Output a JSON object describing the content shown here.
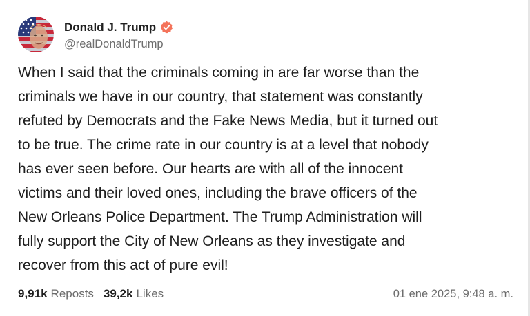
{
  "author": {
    "display_name": "Donald J. Trump",
    "handle": "@realDonaldTrump",
    "verified": true,
    "verified_badge_color": "#f4735a",
    "avatar_icon": "flag-portrait-avatar"
  },
  "post": {
    "lines": [
      "When I said that the criminals coming in are far worse than the",
      "criminals we have in our country, that statement was constantly",
      "refuted by Democrats and the Fake News Media, but it turned out",
      "to be true. The crime rate in our country is at a level that nobody",
      "has ever seen before. Our hearts are with all of the innocent",
      "victims and their loved ones, including the brave officers of the",
      "New Orleans Police Department. The Trump Administration will",
      "fully support the City of New Orleans as they investigate and",
      "recover from this act of pure evil!"
    ]
  },
  "stats": {
    "reposts_count": "9,91k",
    "reposts_label": "Reposts",
    "likes_count": "39,2k",
    "likes_label": "Likes"
  },
  "timestamp": "01 ene 2025, 9:48 a. m."
}
